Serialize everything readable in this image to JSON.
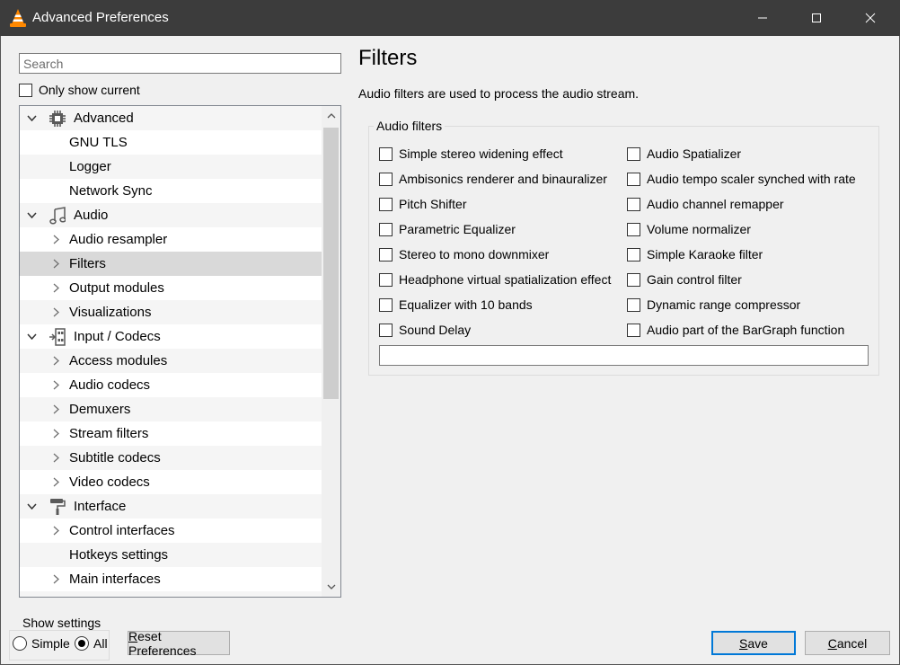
{
  "window": {
    "title": "Advanced Preferences",
    "icon": "vlc-cone-icon"
  },
  "search": {
    "placeholder": "Search",
    "value": ""
  },
  "only_show_current": {
    "label": "Only show current",
    "checked": false
  },
  "tree": {
    "scroll_position": 0,
    "rows": [
      {
        "type": "cat",
        "label": "Advanced",
        "icon": "chip-icon",
        "expanded": true
      },
      {
        "type": "sub",
        "label": "GNU TLS",
        "has_children": false
      },
      {
        "type": "sub",
        "label": "Logger",
        "has_children": false
      },
      {
        "type": "sub",
        "label": "Network Sync",
        "has_children": false
      },
      {
        "type": "cat",
        "label": "Audio",
        "icon": "music-note-icon",
        "expanded": true
      },
      {
        "type": "sub",
        "label": "Audio resampler",
        "has_children": true
      },
      {
        "type": "sub",
        "label": "Filters",
        "has_children": true,
        "selected": true
      },
      {
        "type": "sub",
        "label": "Output modules",
        "has_children": true
      },
      {
        "type": "sub",
        "label": "Visualizations",
        "has_children": true
      },
      {
        "type": "cat",
        "label": "Input / Codecs",
        "icon": "codec-icon",
        "expanded": true
      },
      {
        "type": "sub",
        "label": "Access modules",
        "has_children": true
      },
      {
        "type": "sub",
        "label": "Audio codecs",
        "has_children": true
      },
      {
        "type": "sub",
        "label": "Demuxers",
        "has_children": true
      },
      {
        "type": "sub",
        "label": "Stream filters",
        "has_children": true
      },
      {
        "type": "sub",
        "label": "Subtitle codecs",
        "has_children": true
      },
      {
        "type": "sub",
        "label": "Video codecs",
        "has_children": true
      },
      {
        "type": "cat",
        "label": "Interface",
        "icon": "paint-roller-icon",
        "expanded": true
      },
      {
        "type": "sub",
        "label": "Control interfaces",
        "has_children": true
      },
      {
        "type": "sub",
        "label": "Hotkeys settings",
        "has_children": false
      },
      {
        "type": "sub",
        "label": "Main interfaces",
        "has_children": true
      },
      {
        "type": "cat",
        "label": "",
        "icon": "playlist-icon",
        "expanded": false
      }
    ]
  },
  "panel": {
    "title": "Filters",
    "description": "Audio filters are used to process the audio stream.",
    "group_title": "Audio filters",
    "filter_text": "",
    "left_options": [
      {
        "label": "Simple stereo widening effect",
        "checked": false
      },
      {
        "label": "Ambisonics renderer and binauralizer",
        "checked": false
      },
      {
        "label": "Pitch Shifter",
        "checked": false
      },
      {
        "label": "Parametric Equalizer",
        "checked": false
      },
      {
        "label": "Stereo to mono downmixer",
        "checked": false
      },
      {
        "label": "Headphone virtual spatialization effect",
        "checked": false
      },
      {
        "label": "Equalizer with 10 bands",
        "checked": false
      },
      {
        "label": "Sound Delay",
        "checked": false
      }
    ],
    "right_options": [
      {
        "label": "Audio Spatializer",
        "checked": false
      },
      {
        "label": "Audio tempo scaler synched with rate",
        "checked": false
      },
      {
        "label": "Audio channel remapper",
        "checked": false
      },
      {
        "label": "Volume normalizer",
        "checked": false
      },
      {
        "label": "Simple Karaoke filter",
        "checked": false
      },
      {
        "label": "Gain control filter",
        "checked": false
      },
      {
        "label": "Dynamic range compressor",
        "checked": false
      },
      {
        "label": "Audio part of the BarGraph function",
        "checked": false
      }
    ]
  },
  "bottom": {
    "show_settings_title": "Show settings",
    "simple_label": "Simple",
    "all_label": "All",
    "selected_mode": "All",
    "reset_label": "Reset Preferences",
    "save_label": "Save",
    "cancel_label": "Cancel"
  }
}
